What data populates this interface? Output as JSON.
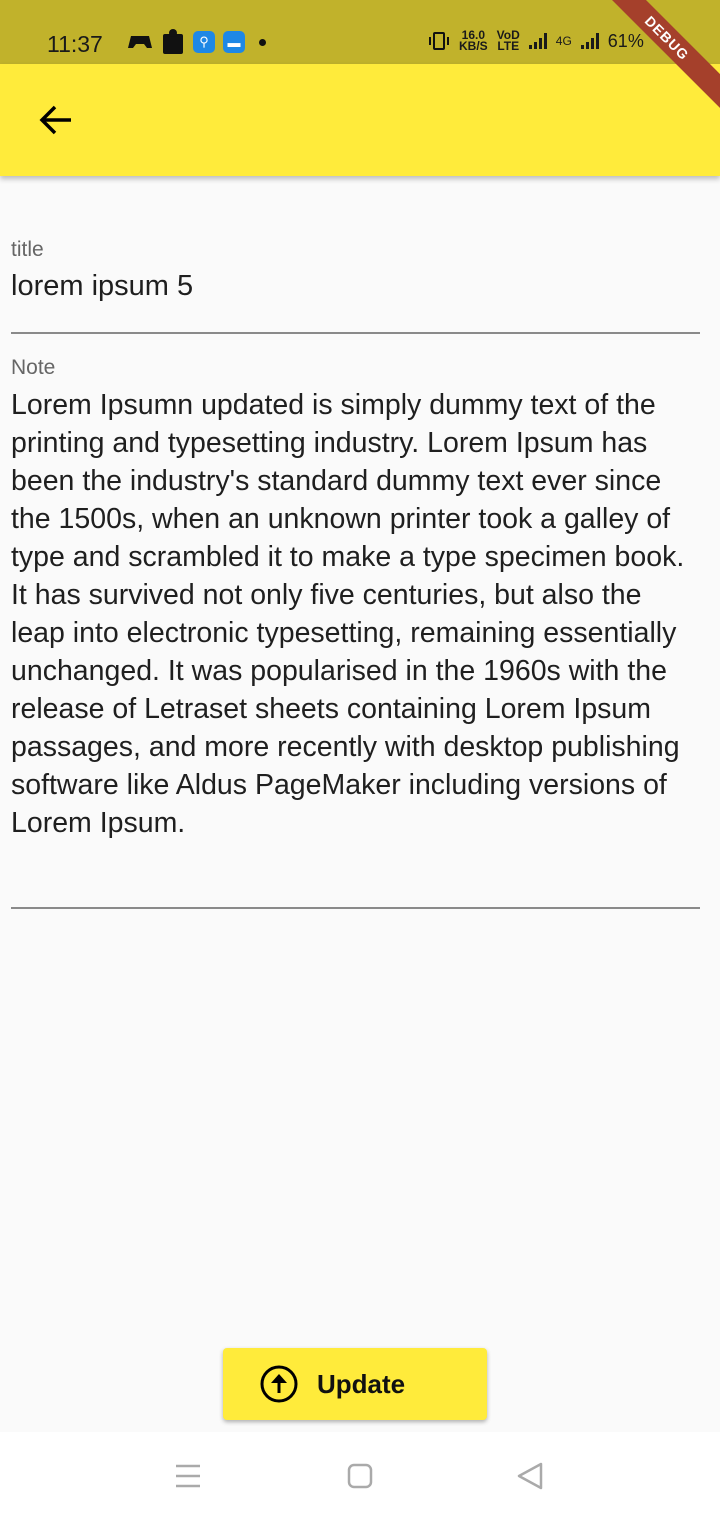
{
  "status_bar": {
    "time": "11:37",
    "speed_value": "16.0",
    "speed_unit": "KB/S",
    "volte_top": "VoD",
    "volte_bottom": "LTE",
    "network": "4G",
    "battery": "61%"
  },
  "debug_banner": "DEBUG",
  "app_bar": {
    "back_icon": "arrow-back-icon"
  },
  "form": {
    "title_label": "title",
    "title_value": "lorem ipsum 5",
    "note_label": "Note",
    "note_value": "Lorem Ipsumn updated is simply dummy text of the printing and typesetting industry. Lorem Ipsum has been the industry's standard dummy text ever since the 1500s, when an unknown printer took a galley of type and scrambled it to make a type specimen book. It has survived not only five centuries, but also the leap into electronic typesetting, remaining essentially unchanged. It was popularised in the 1960s with the release of Letraset sheets containing Lorem Ipsum passages, and more recently with desktop publishing software like Aldus PageMaker including versions of Lorem Ipsum."
  },
  "update_button": {
    "label": "Update",
    "icon": "arrow-up-circle-icon"
  },
  "nav_bar": {
    "icons": [
      "menu-icon",
      "home-icon",
      "back-icon"
    ]
  },
  "colors": {
    "accent": "#ffeb3b",
    "status_bar": "#c1b22b",
    "debug": "#a5402b"
  }
}
